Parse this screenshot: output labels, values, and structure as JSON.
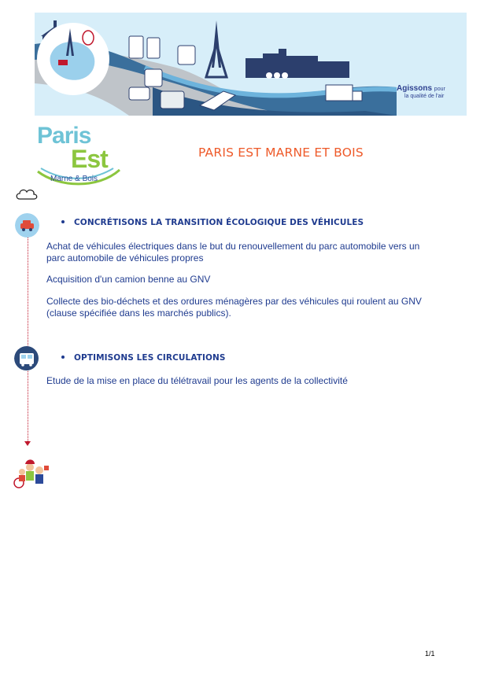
{
  "header": {
    "banner_badge_line1": "Agissons",
    "banner_badge_line1b": "pour",
    "banner_badge_line2": "la qualité de l'air"
  },
  "logo": {
    "paris": "Paris",
    "est": "Est",
    "sub": "Marne & Bois"
  },
  "title": "PARIS EST MARNE ET BOIS",
  "sections": [
    {
      "heading": "CONCRÉTISONS LA TRANSITION ÉCOLOGIQUE DES VÉHICULES",
      "paragraphs": [
        "Achat de véhicules électriques dans le but du renouvellement du parc automobile vers un parc automobile de véhicules propres",
        "Acquisition d'un camion benne au GNV",
        "Collecte des bio-déchets et des ordures ménagères par des véhicules qui roulent au GNV (clause spécifiée dans les marchés publics)."
      ]
    },
    {
      "heading": "OPTIMISONS LES CIRCULATIONS",
      "paragraphs": [
        "Etude de la mise en place du télétravail pour les agents de la collectivité"
      ]
    }
  ],
  "footer": {
    "page_number": "1/1"
  },
  "colors": {
    "accent_title": "#ee5a2a",
    "text_blue": "#1f3b8f",
    "timeline_red": "#c0182d"
  }
}
